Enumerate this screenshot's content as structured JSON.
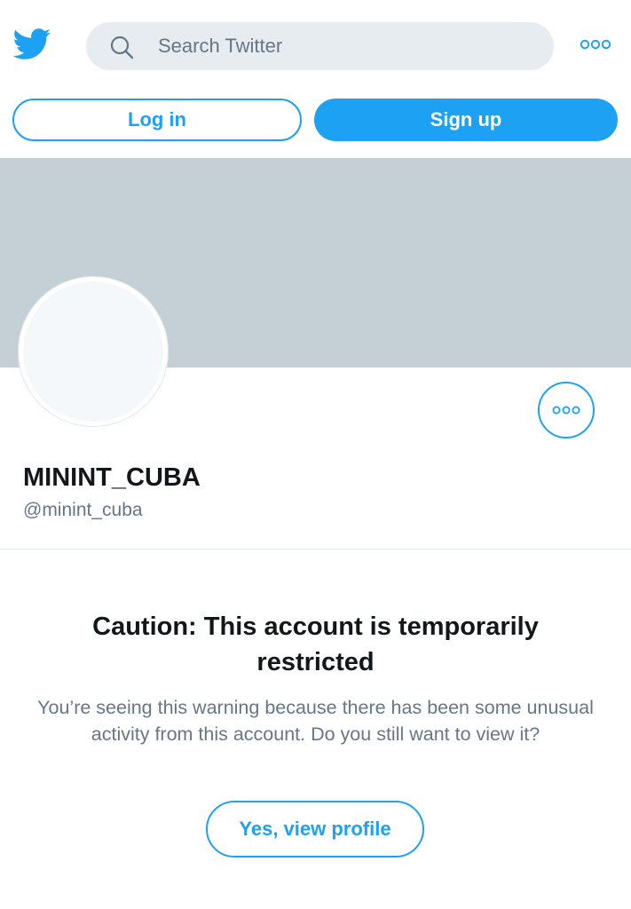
{
  "header": {
    "logo_icon": "twitter-bird-icon",
    "search_placeholder": "Search Twitter",
    "search_icon": "search-icon",
    "more_icon": "more-options-icon"
  },
  "auth": {
    "login_label": "Log in",
    "signup_label": "Sign up"
  },
  "profile": {
    "name": "MININT_CUBA",
    "handle": "@minint_cuba",
    "more_icon": "more-options-icon"
  },
  "warning": {
    "title": "Caution: This account is temporarily restricted",
    "body": "You’re seeing this warning because there has been some unusual activity from this account. Do you still want to view it?",
    "button_label": "Yes, view profile"
  },
  "colors": {
    "accent": "#1da1f2",
    "banner": "#c4cfd6",
    "search_bg": "#e6ecf0",
    "secondary_text": "#657786"
  }
}
